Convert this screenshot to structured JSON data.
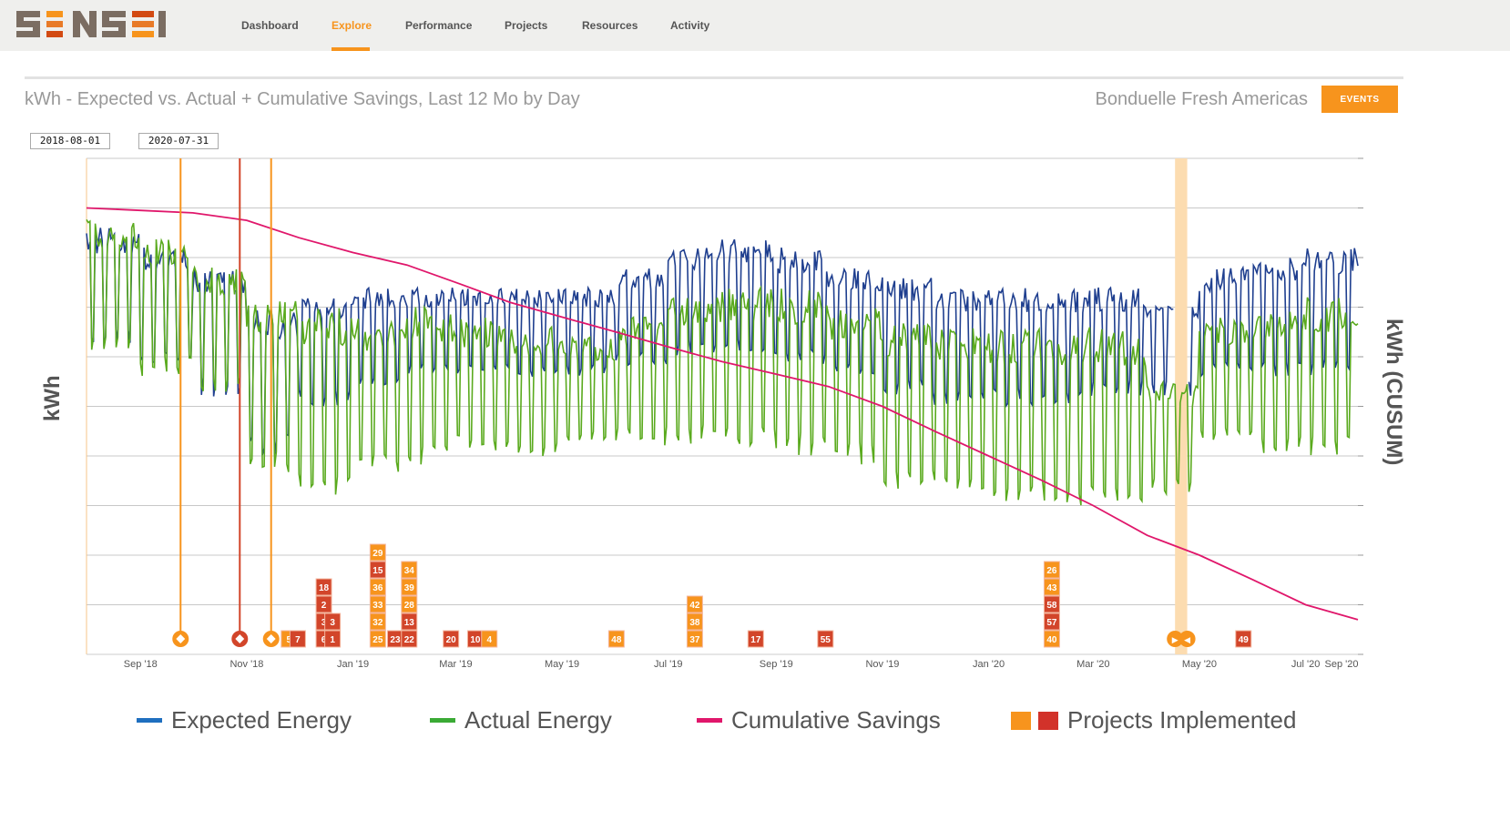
{
  "nav": {
    "logo": "SENSEI",
    "items": [
      {
        "label": "Dashboard"
      },
      {
        "label": "Explore",
        "active": true
      },
      {
        "label": "Performance"
      },
      {
        "label": "Projects"
      },
      {
        "label": "Resources"
      },
      {
        "label": "Activity"
      }
    ]
  },
  "header": {
    "title": "kWh - Expected vs. Actual + Cumulative Savings, Last 12 Mo by Day",
    "company": "Bonduelle Fresh Americas",
    "events_button": "EVENTS"
  },
  "date_range": {
    "start": "2018-08-01",
    "end": "2020-07-31"
  },
  "colors": {
    "expected": "#1f3f8f",
    "actual": "#5aaa1e",
    "cusum": "#e0176b",
    "project_orange": "#f7941d",
    "project_red": "#d2452a",
    "event_band": "#fcdcb0",
    "accent": "#f7941d"
  },
  "chart_data": {
    "type": "line",
    "ylabel": "kWh",
    "ylabel_right": "kWh (CUSUM)",
    "xlim": [
      "2018-08-01",
      "2020-07-31"
    ],
    "ylim": [
      0,
      100
    ],
    "grid": true,
    "x_ticks": [
      {
        "date": "2018-09-01",
        "label": "Sep '18"
      },
      {
        "date": "2018-11-01",
        "label": "Nov '18"
      },
      {
        "date": "2019-01-01",
        "label": "Jan '19"
      },
      {
        "date": "2019-03-01",
        "label": "Mar '19"
      },
      {
        "date": "2019-05-01",
        "label": "May '19"
      },
      {
        "date": "2019-07-01",
        "label": "Jul '19"
      },
      {
        "date": "2019-09-01",
        "label": "Sep '19"
      },
      {
        "date": "2019-11-01",
        "label": "Nov '19"
      },
      {
        "date": "2020-01-01",
        "label": "Jan '20"
      },
      {
        "date": "2020-03-01",
        "label": "Mar '20"
      },
      {
        "date": "2020-05-01",
        "label": "May '20"
      },
      {
        "date": "2020-07-01",
        "label": "Jul '20"
      },
      {
        "date": "2020-07-31",
        "label": "Sep '20"
      }
    ],
    "months": [
      "2018-08",
      "2018-09",
      "2018-10",
      "2018-11",
      "2018-12",
      "2019-01",
      "2019-02",
      "2019-03",
      "2019-04",
      "2019-05",
      "2019-06",
      "2019-07",
      "2019-08",
      "2019-09",
      "2019-10",
      "2019-11",
      "2019-12",
      "2020-01",
      "2020-02",
      "2020-03",
      "2020-04",
      "2020-05",
      "2020-06",
      "2020-07"
    ],
    "series": [
      {
        "name": "Expected Energy",
        "color": "#1f3f8f",
        "weekday_peak": [
          86,
          82,
          78,
          70,
          72,
          74,
          74,
          74,
          74,
          74,
          78,
          82,
          84,
          82,
          78,
          76,
          74,
          74,
          74,
          74,
          72,
          78,
          80,
          82
        ],
        "weekend_low": [
          62,
          58,
          52,
          40,
          50,
          54,
          56,
          56,
          56,
          56,
          58,
          60,
          60,
          58,
          56,
          52,
          50,
          50,
          50,
          52,
          52,
          56,
          56,
          56
        ],
        "gap": [
          "2020-04-17",
          "2020-04-24"
        ]
      },
      {
        "name": "Actual Energy",
        "color": "#5aaa1e",
        "weekday_peak": [
          88,
          84,
          78,
          72,
          70,
          68,
          70,
          68,
          66,
          64,
          68,
          72,
          74,
          74,
          70,
          68,
          66,
          66,
          66,
          66,
          55,
          68,
          70,
          72
        ],
        "weekend_low": [
          60,
          56,
          52,
          36,
          32,
          36,
          38,
          40,
          40,
          42,
          42,
          42,
          42,
          40,
          38,
          32,
          32,
          30,
          30,
          30,
          32,
          42,
          40,
          40
        ]
      },
      {
        "name": "Cumulative Savings",
        "color": "#e0176b",
        "monthly": [
          90,
          89.5,
          89,
          87.5,
          84,
          81,
          78.5,
          75,
          71,
          68,
          65,
          62,
          59,
          56.5,
          54,
          50,
          45,
          40,
          35,
          30,
          24,
          20,
          15,
          10,
          7
        ]
      }
    ],
    "events": [
      {
        "date": "2018-09-24",
        "color": "#f7941d"
      },
      {
        "date": "2018-10-28",
        "color": "#d2452a"
      },
      {
        "date": "2018-11-15",
        "color": "#f7941d"
      }
    ],
    "event_band": [
      "2020-04-17",
      "2020-04-24"
    ],
    "band_markers": [
      {
        "date": "2020-04-17",
        "glyph": "▶"
      },
      {
        "date": "2020-04-24",
        "glyph": "◀"
      }
    ],
    "projects": [
      {
        "date": "2018-11-25",
        "items": [
          {
            "id": "5",
            "c": "o"
          }
        ]
      },
      {
        "date": "2018-11-30",
        "items": [
          {
            "id": "7",
            "c": "r"
          }
        ]
      },
      {
        "date": "2018-12-15",
        "items": [
          {
            "id": "6",
            "c": "r"
          },
          {
            "id": "3",
            "c": "r"
          },
          {
            "id": "2",
            "c": "r"
          },
          {
            "id": "18",
            "c": "r"
          }
        ]
      },
      {
        "date": "2018-12-20",
        "items": [
          {
            "id": "1",
            "c": "r"
          },
          {
            "id": "3",
            "c": "r"
          }
        ]
      },
      {
        "date": "2019-01-15",
        "items": [
          {
            "id": "25",
            "c": "o"
          },
          {
            "id": "32",
            "c": "o"
          },
          {
            "id": "33",
            "c": "o"
          },
          {
            "id": "36",
            "c": "o"
          },
          {
            "id": "15",
            "c": "r"
          },
          {
            "id": "29",
            "c": "o"
          }
        ]
      },
      {
        "date": "2019-01-25",
        "items": [
          {
            "id": "23",
            "c": "r"
          }
        ]
      },
      {
        "date": "2019-02-02",
        "items": [
          {
            "id": "22",
            "c": "r"
          },
          {
            "id": "13",
            "c": "r"
          },
          {
            "id": "28",
            "c": "o"
          },
          {
            "id": "39",
            "c": "o"
          },
          {
            "id": "34",
            "c": "o"
          }
        ]
      },
      {
        "date": "2019-02-26",
        "items": [
          {
            "id": "20",
            "c": "r"
          }
        ]
      },
      {
        "date": "2019-03-12",
        "items": [
          {
            "id": "10",
            "c": "r"
          }
        ]
      },
      {
        "date": "2019-03-20",
        "items": [
          {
            "id": "4",
            "c": "o"
          }
        ]
      },
      {
        "date": "2019-06-01",
        "items": [
          {
            "id": "48",
            "c": "o"
          }
        ]
      },
      {
        "date": "2019-07-16",
        "items": [
          {
            "id": "37",
            "c": "o"
          },
          {
            "id": "38",
            "c": "o"
          },
          {
            "id": "42",
            "c": "o"
          }
        ]
      },
      {
        "date": "2019-08-20",
        "items": [
          {
            "id": "17",
            "c": "r"
          }
        ]
      },
      {
        "date": "2019-09-29",
        "items": [
          {
            "id": "55",
            "c": "r"
          }
        ]
      },
      {
        "date": "2020-02-06",
        "items": [
          {
            "id": "40",
            "c": "o"
          },
          {
            "id": "57",
            "c": "r"
          },
          {
            "id": "58",
            "c": "r"
          },
          {
            "id": "43",
            "c": "o"
          },
          {
            "id": "26",
            "c": "o"
          }
        ]
      },
      {
        "date": "2020-05-26",
        "items": [
          {
            "id": "49",
            "c": "r"
          }
        ]
      }
    ],
    "legend": [
      {
        "label": "Expected Energy",
        "color": "#1f6fbf"
      },
      {
        "label": "Actual Energy",
        "color": "#3aaa35"
      },
      {
        "label": "Cumulative Savings",
        "color": "#e0176b"
      },
      {
        "label": "Projects Implemented",
        "colors": [
          "#f7941d",
          "#d2322a"
        ]
      }
    ]
  }
}
